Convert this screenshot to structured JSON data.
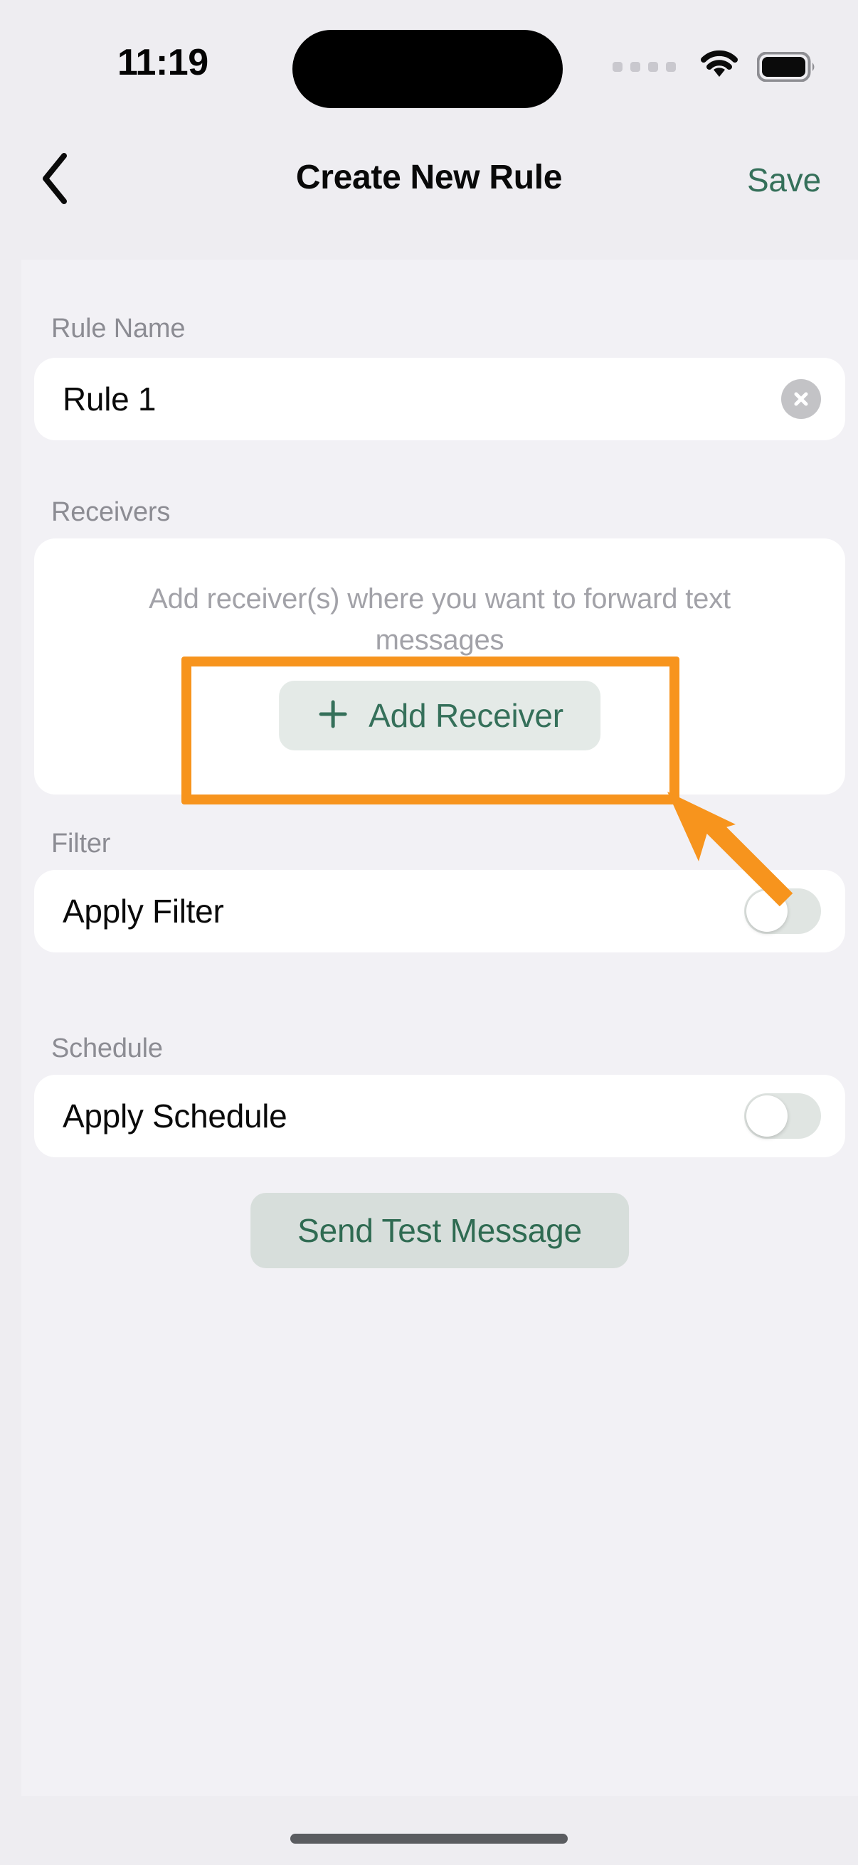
{
  "status_bar": {
    "time": "11:19",
    "signal_icon": "cellular-dots-icon",
    "wifi_icon": "wifi-icon",
    "battery_icon": "battery-full-icon"
  },
  "header": {
    "back_icon": "chevron-left-icon",
    "title": "Create New Rule",
    "save_label": "Save"
  },
  "form": {
    "rule_name": {
      "label": "Rule Name",
      "value": "Rule 1",
      "placeholder": "Rule Name",
      "clear_icon": "close-circle-icon"
    },
    "receivers": {
      "label": "Receivers",
      "hint": "Add receiver(s) where you want to forward text messages",
      "add_button_label": "Add Receiver",
      "add_button_icon": "plus-icon"
    },
    "filter": {
      "label": "Filter",
      "row_label": "Apply Filter",
      "toggle_state": "off"
    },
    "schedule": {
      "label": "Schedule",
      "row_label": "Apply Schedule",
      "toggle_state": "off"
    },
    "send_test_label": "Send Test Message"
  },
  "annotation": {
    "color": "#f7941d",
    "target": "add-receiver-button",
    "arrow_icon": "arrow-up-left-icon"
  },
  "colors": {
    "accent_green": "#35705a",
    "page_background": "#eeedf1",
    "content_background": "#f2f1f5",
    "card_background": "#ffffff",
    "label_gray": "#8c8c93",
    "hint_gray": "#a2a2a8",
    "highlight_orange": "#f7941d"
  }
}
